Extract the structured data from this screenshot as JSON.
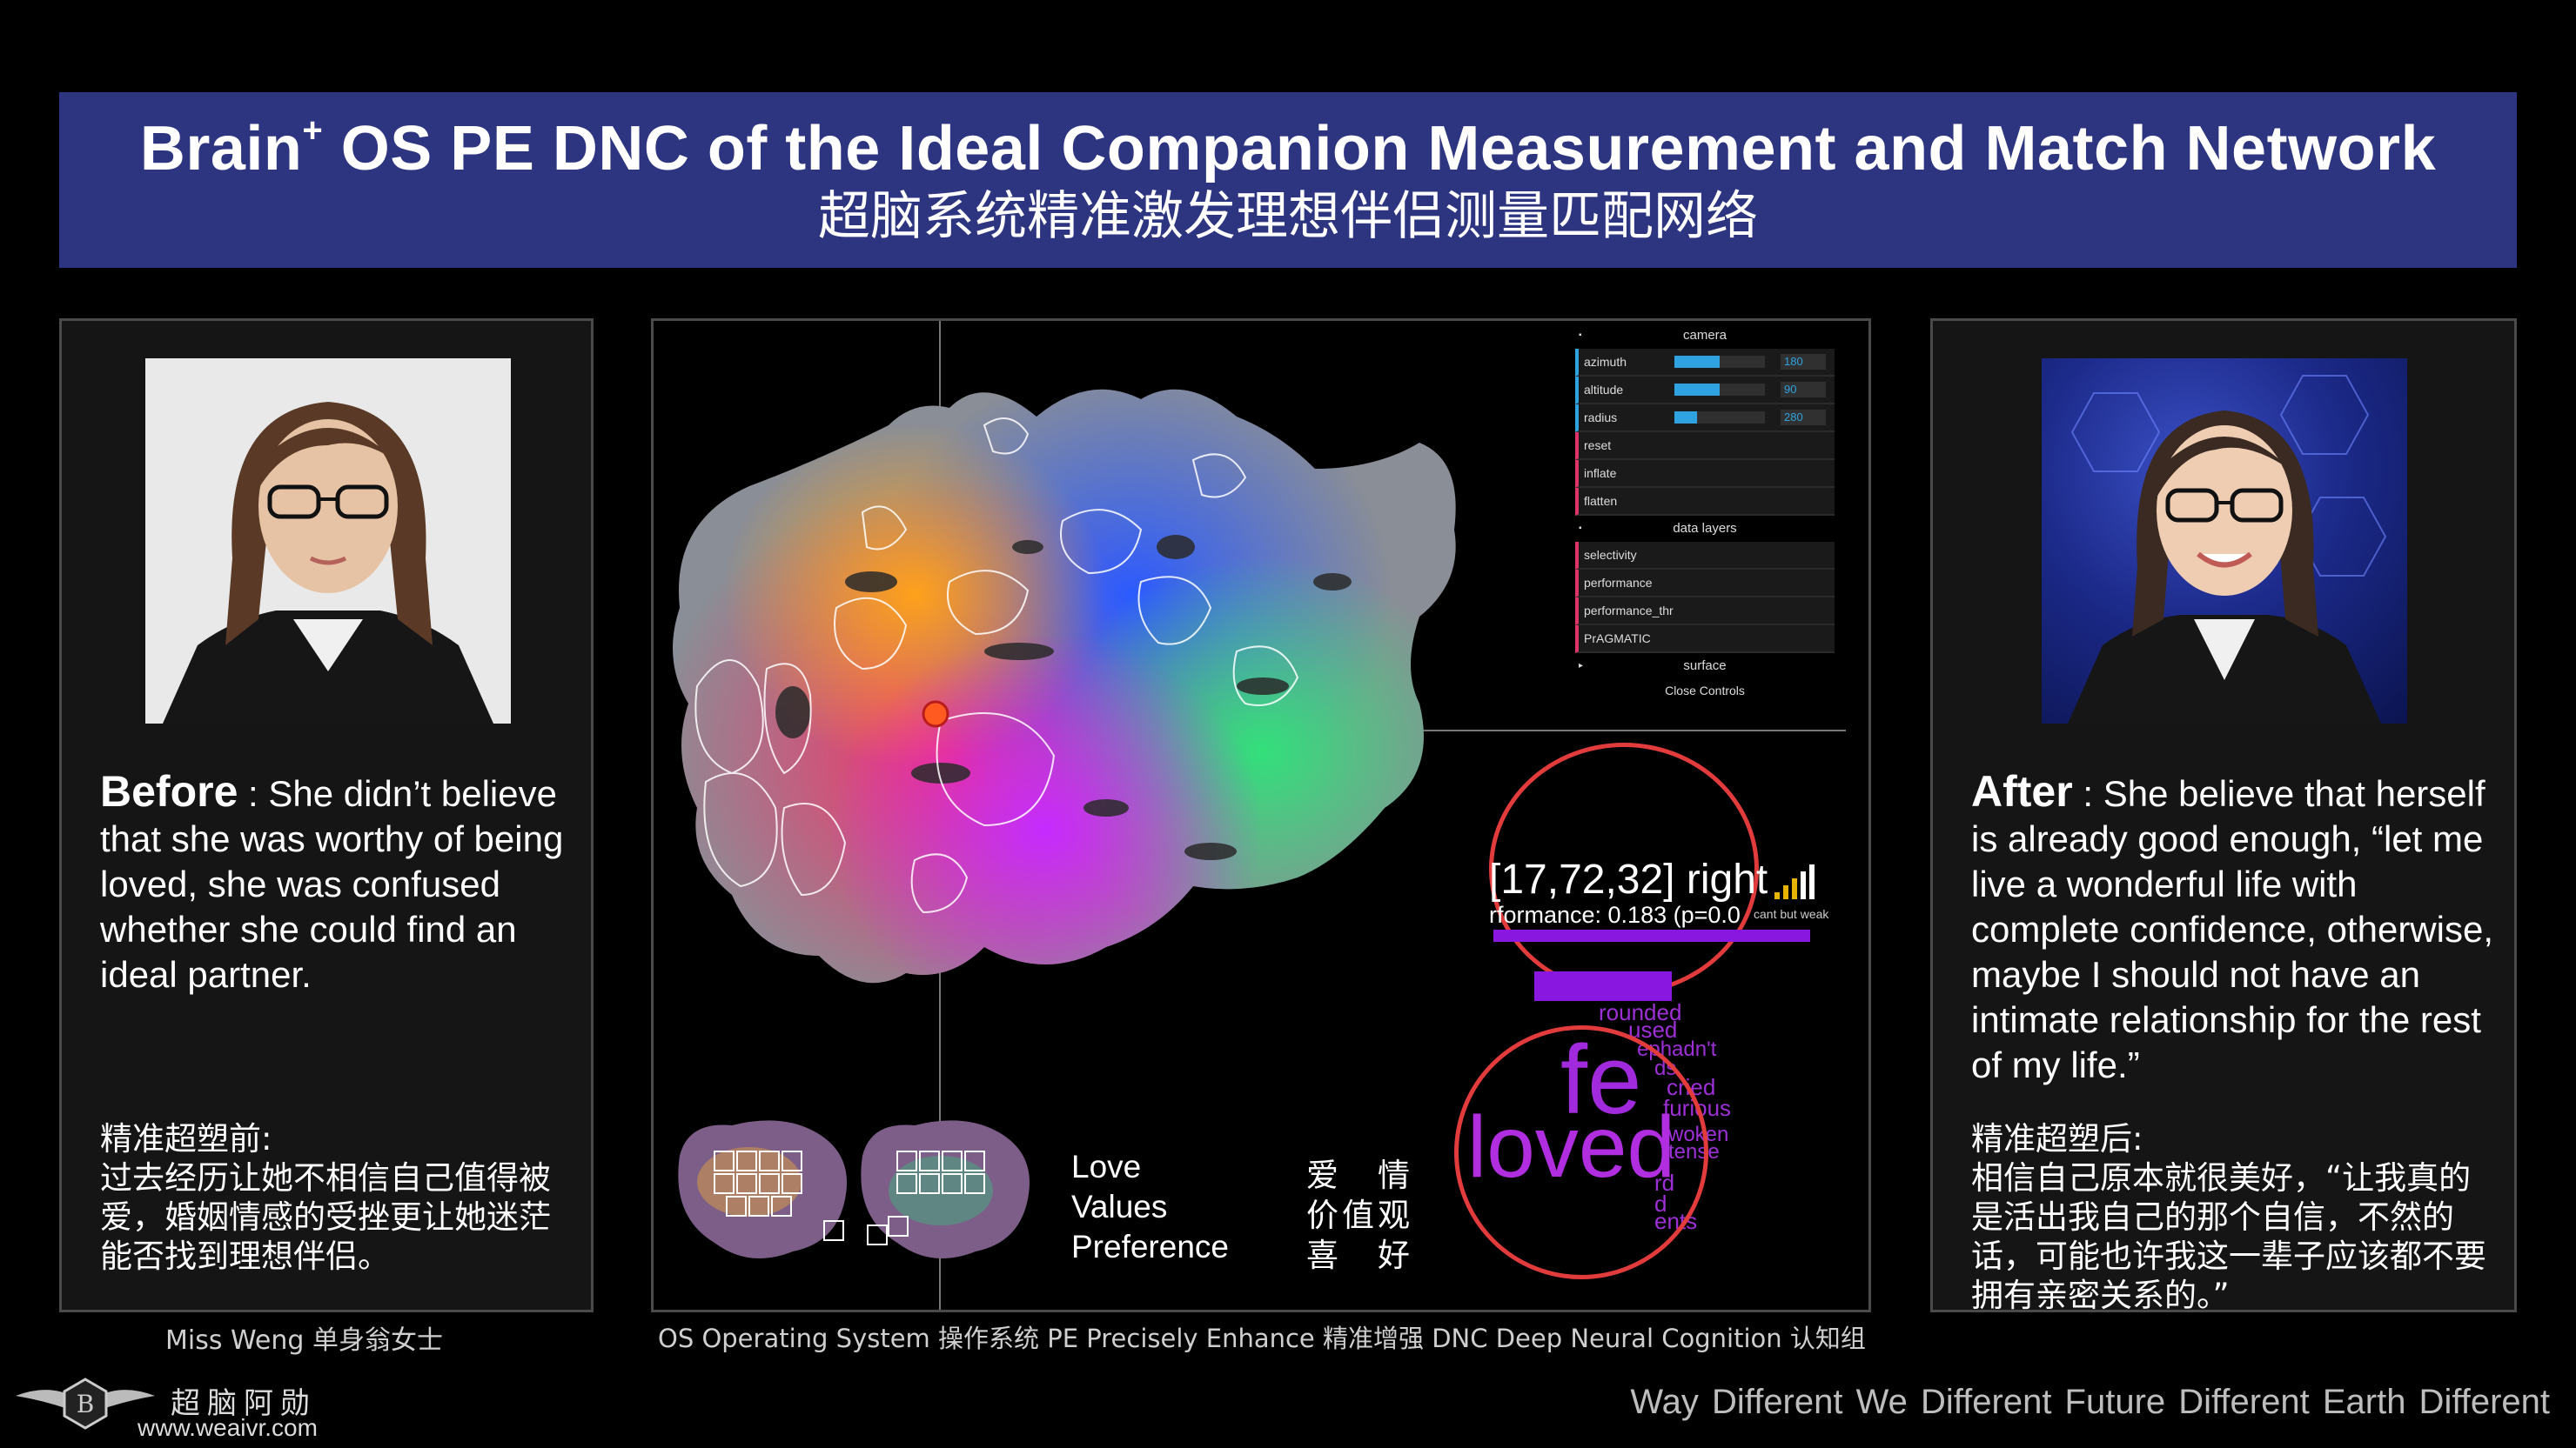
{
  "banner": {
    "title_en_prefix": "Brain",
    "title_en_sup": "+",
    "title_en_rest": " OS PE DNC of the Ideal Companion Measurement and Match Network",
    "title_zh": "超脑系统精准激发理想伴侣测量匹配网络"
  },
  "before": {
    "label": "Before",
    "text": " : She didn’t believe that she was worthy of being loved, she was confused whether she could find an ideal partner.",
    "zh_heading": "精准超塑前:",
    "zh_text": "过去经历让她不相信自己值得被爱，婚姻情感的受挫更让她迷茫能否找到理想伴侣。",
    "caption": "Miss Weng 单身翁女士"
  },
  "after": {
    "label": "After",
    "text": " : She believe that herself is already good enough, “let me live a wonderful life with complete confidence, otherwise, maybe I should not have an intimate relationship for the rest of my life.”",
    "zh_heading": "精准超塑后:",
    "zh_text": "相信自己原本就很美好，“让我真的是活出我自己的那个自信，不然的话，可能也许我这一辈子应该都不要拥有亲密关系的。”"
  },
  "viewer": {
    "controls": {
      "camera_label": "camera",
      "sliders": [
        {
          "label": "azimuth",
          "value": "180",
          "fraction": 0.5
        },
        {
          "label": "altitude",
          "value": "90",
          "fraction": 0.5
        },
        {
          "label": "radius",
          "value": "280",
          "fraction": 0.25
        }
      ],
      "buttons": [
        "reset",
        "inflate",
        "flatten"
      ],
      "data_layers_label": "data layers",
      "layers": [
        "selectivity",
        "performance",
        "performance_thr",
        "PrAGMATIC"
      ],
      "surface_label": "surface",
      "close_label": "Close Controls"
    },
    "readout": {
      "coord": "[17,72,32] right",
      "performance": "rformance: 0.183 (p=0.0",
      "significance": "cant but weak"
    },
    "word_cloud": {
      "big1": "fe",
      "big2": "loved",
      "small": [
        "rounded",
        "used",
        "ephadn't",
        "ds",
        "cried",
        "furious",
        "woken",
        "tense",
        "rd",
        "d",
        "ents"
      ]
    },
    "legend": {
      "en": [
        "Love",
        "Values",
        "Preference"
      ],
      "zh": [
        "爱　情",
        "价值观",
        "喜　好"
      ]
    },
    "footnote": "OS Operating System 操作系统  PE Precisely Enhance 精准增强 DNC Deep Neural Cognition  认知组"
  },
  "footer": {
    "brand_zh": "超脑阿勋",
    "brand_url": "www.weaivr.com",
    "tagline": "Way Different   We Different   Future Different   Earth Different"
  },
  "colors": {
    "banner_bg": "#2d3580",
    "accent_blue": "#2fa3e0",
    "accent_pink": "#e0336a",
    "circle_red": "#e23b3b",
    "purple": "#8a17e0"
  }
}
